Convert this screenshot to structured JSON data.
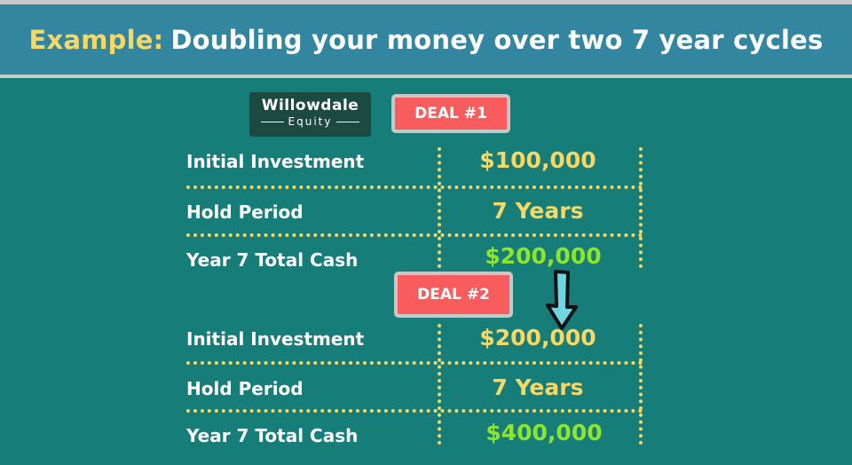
{
  "banner": {
    "highlight": "Example:",
    "title": "Doubling your money over two 7 year cycles"
  },
  "logo": {
    "name": "Willowdale",
    "tagline": "Equity"
  },
  "deals": [
    {
      "badge": "DEAL #1",
      "rows": [
        {
          "label": "Initial Investment",
          "value": "$100,000"
        },
        {
          "label": "Hold Period",
          "value": "7 Years"
        },
        {
          "label": "Year 7 Total Cash",
          "value": "$200,000"
        }
      ]
    },
    {
      "badge": "DEAL #2",
      "rows": [
        {
          "label": "Initial Investment",
          "value": "$200,000"
        },
        {
          "label": "Hold Period",
          "value": "7 Years"
        },
        {
          "label": "Year 7 Total Cash",
          "value": "$400,000"
        }
      ]
    }
  ],
  "colors": {
    "background": "#177d78",
    "banner": "#3286a0",
    "accent_yellow": "#f6d867",
    "cash_green": "#8ee52e",
    "badge_red": "#f95c5c",
    "arrow": "#6ed6e0"
  },
  "icons": {
    "flow_arrow": "arrow-down-icon"
  }
}
